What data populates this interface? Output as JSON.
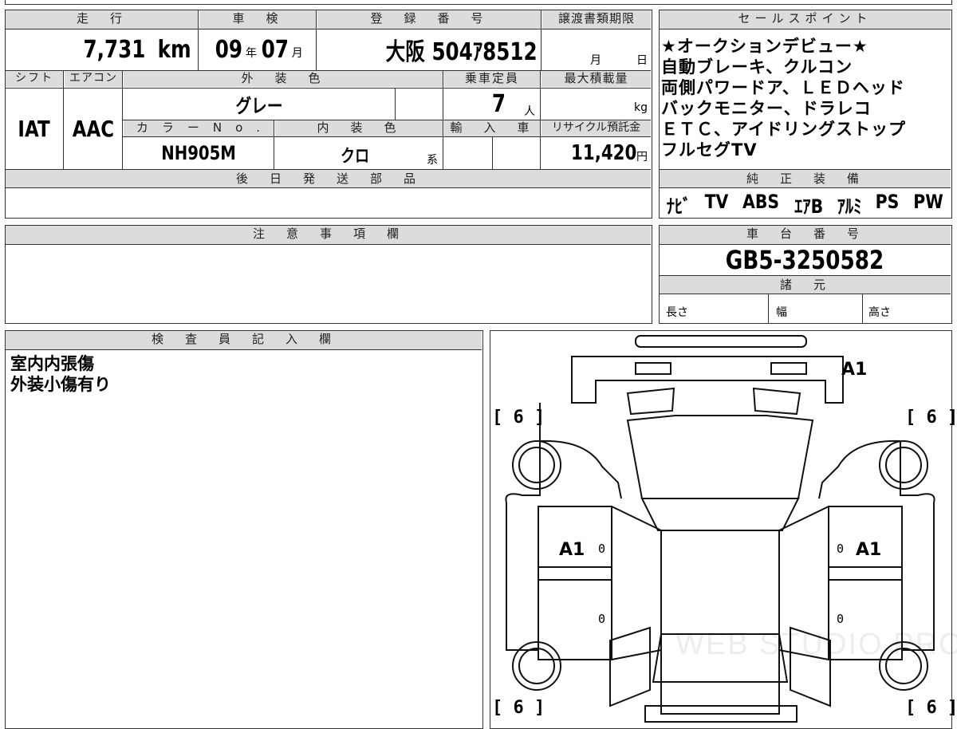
{
  "top_strip": {
    "partial": ""
  },
  "sheet": {
    "mileage": {
      "label": "走　行",
      "value": "7,731",
      "unit": "km"
    },
    "inspection": {
      "label": "車　検",
      "year": "09",
      "year_unit": "年",
      "month": "07",
      "month_unit": "月"
    },
    "registration": {
      "label": "登　録　番　号",
      "value": "大阪 504ｱ8512"
    },
    "transfer_deadline": {
      "label": "譲渡書類期限",
      "month_unit": "月",
      "day_unit": "日"
    },
    "shift": {
      "label": "シフト",
      "value": "IAT"
    },
    "aircon": {
      "label": "エアコン",
      "value": "AAC"
    },
    "exterior_color": {
      "label": "外　装　色",
      "value": "グレー"
    },
    "capacity": {
      "label": "乗車定員",
      "value": "7",
      "unit": "人"
    },
    "max_load": {
      "label": "最大積載量",
      "unit": "kg"
    },
    "color_no": {
      "label": "カ　ラ　ー　N　o　.",
      "value": "NH905M"
    },
    "interior_color": {
      "label": "内　装　色",
      "value": "クロ",
      "suffix": "系"
    },
    "import": {
      "label": "輸　入　車"
    },
    "recycle": {
      "label": "リサイクル預託金",
      "value": "11,420",
      "unit": "円"
    },
    "later_parts": {
      "label": "後　日　発　送　部　品"
    },
    "notes": {
      "label": "注　意　事　項　欄"
    },
    "inspector": {
      "label": "検　査　員　記　入　欄",
      "lines": [
        "室内内張傷",
        "外装小傷有り"
      ]
    }
  },
  "sales_points": {
    "label": "セールスポイント",
    "lines": [
      "★オークションデビュー★",
      "自動ブレーキ、クルコン",
      "両側パワードア、ＬＥＤヘッド",
      "バックモニター、ドラレコ",
      "ＥＴＣ、アイドリングストップ",
      "フルセグTV"
    ]
  },
  "equipment": {
    "label": "純　正　装　備",
    "items": [
      "ﾅﾋﾞ",
      "TV",
      "ABS",
      "ｴｱB",
      "ｱﾙﾐ",
      "PS",
      "PW"
    ]
  },
  "chassis": {
    "label": "車　台　番　号",
    "value": "GB5-3250582"
  },
  "specs": {
    "label": "諸　元",
    "length": "長さ",
    "width": "幅",
    "height": "高さ"
  },
  "diagram": {
    "marks": {
      "front": "A1",
      "left_front_door": "A1",
      "right_front_door": "A1"
    },
    "bracket_value": "6",
    "zero": "0",
    "watermark": "WEB STUDIO PRO"
  }
}
